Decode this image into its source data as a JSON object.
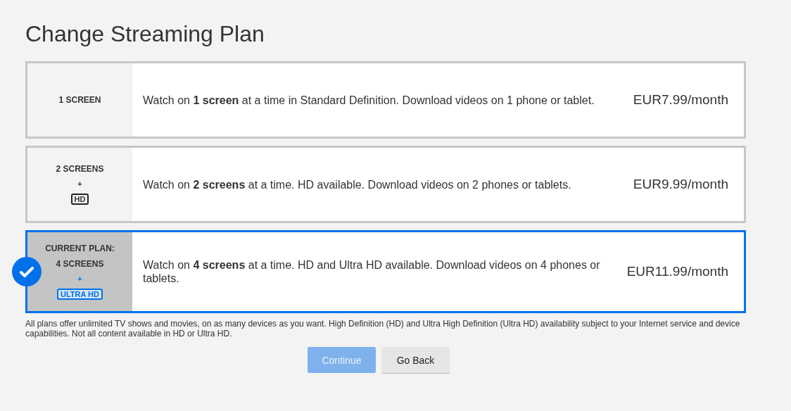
{
  "title": "Change Streaming Plan",
  "plans": [
    {
      "name": "1 SCREEN",
      "description": "Watch on **1 screen** at a time in Standard Definition. Download videos on 1 phone or tablet.",
      "price": "EUR7.99/month",
      "selected": false
    },
    {
      "name": "2 SCREENS",
      "plus": "+",
      "badge": {
        "kind": "hd",
        "text": "HD"
      },
      "description": "Watch on **2 screens** at a time. HD available. Download videos on 2 phones or tablets.",
      "price": "EUR9.99/month",
      "selected": false
    },
    {
      "current_label": "CURRENT PLAN:",
      "name": "4 SCREENS",
      "plus": "+",
      "badge": {
        "kind": "ultra",
        "text": "ULTRA HD"
      },
      "description": "Watch on **4 screens** at a time. HD and Ultra HD available. Download videos on 4 phones or tablets.",
      "price": "EUR11.99/month",
      "selected": true
    }
  ],
  "footnote": "All plans offer unlimited TV shows and movies, on as many devices as you want. High Definition (HD) and Ultra High Definition (Ultra HD) availability subject to your Internet service and device capabilities. Not all content available in HD or Ultra HD.",
  "buttons": [
    {
      "label": "Continue",
      "kind": "primary",
      "disabled": true
    },
    {
      "label": "Go Back",
      "kind": "secondary"
    }
  ]
}
